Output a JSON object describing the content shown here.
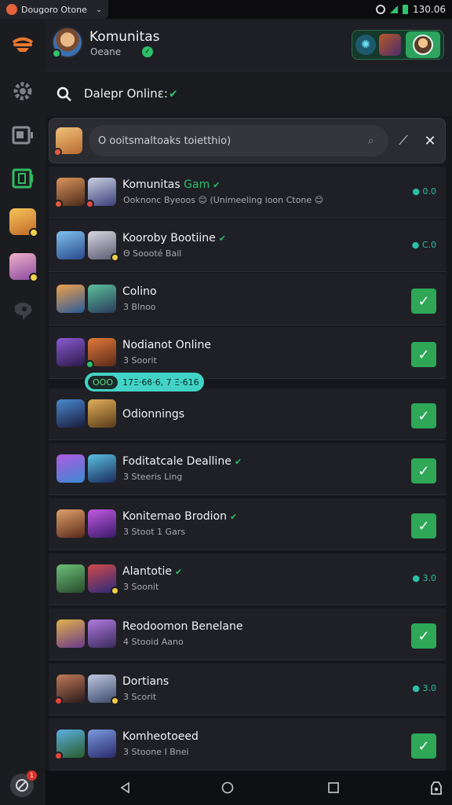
{
  "status_bar": {
    "app_name": "Dougoro Otone",
    "time": "130.06"
  },
  "header": {
    "title": "Komunitas",
    "subtitle": "Oeane"
  },
  "title_row": {
    "title": "Dalepr Onlinε:"
  },
  "search": {
    "placeholder": "Ο ooitsmaltoaks toietthio)"
  },
  "rows": [
    {
      "name": "Komunitas",
      "tag": "Gam",
      "sub": "Ooknonc Byeoos 😊 (Unimeeling ioon Ctone 😊",
      "status": "0.0"
    },
    {
      "name": "Kooroby Bootiine",
      "sub": "Θ Soooté Bail",
      "status": "C.0"
    },
    {
      "name": "Colino",
      "sub": "3 Blnoo"
    },
    {
      "name": "Nodianot Online",
      "sub": "3 Soorit"
    },
    {
      "name": "Odionnings",
      "sub": ""
    },
    {
      "name": "Foditatcale Dealline",
      "sub": "3 Steeris Ling"
    },
    {
      "name": "Konitemao Brodion",
      "sub": "3 Stoot 1 Gars"
    },
    {
      "name": "Alantotie",
      "sub": "3 Soonit",
      "status": "3.0"
    },
    {
      "name": "Reodoomon Benelane",
      "sub": "4 Stooid Aano"
    },
    {
      "name": "Dortians",
      "sub": "3 Scorit",
      "status": "3.0"
    },
    {
      "name": "Komheotoeed",
      "sub": "3 Stoone I Bnei"
    }
  ],
  "pill": {
    "left": "OOO",
    "right": "17Ξ·6ϐ·6, 7 Ξ·616"
  },
  "icons": {
    "rail": [
      "logo-icon",
      "settings-icon",
      "window-icon",
      "tablet-icon",
      "chat-icon"
    ],
    "nav": [
      "back-icon",
      "home-icon",
      "recents-icon",
      "lock-icon"
    ]
  },
  "colors": {
    "accent": "#2ea757",
    "background": "#16171b",
    "panel": "#1f2025",
    "cyan": "#42d3c6"
  }
}
